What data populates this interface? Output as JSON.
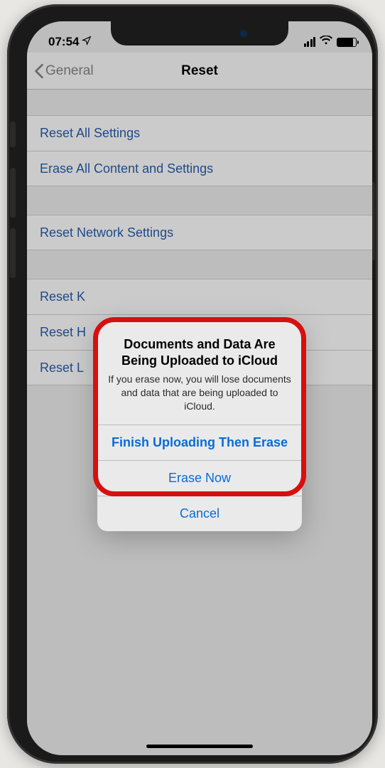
{
  "statusBar": {
    "time": "07:54"
  },
  "nav": {
    "back": "General",
    "title": "Reset"
  },
  "groups": [
    {
      "rows": [
        {
          "label": "Reset All Settings"
        },
        {
          "label": "Erase All Content and Settings"
        }
      ]
    },
    {
      "rows": [
        {
          "label": "Reset Network Settings"
        }
      ]
    },
    {
      "rows": [
        {
          "label": "Reset Keyboard Dictionary"
        },
        {
          "label": "Reset Home Screen Layout"
        },
        {
          "label": "Reset Location & Privacy"
        }
      ]
    }
  ],
  "visibleRowPrefixes": {
    "r3a": "Reset K",
    "r3b": "Reset H",
    "r3c": "Reset L"
  },
  "alert": {
    "title": "Documents and Data Are Being Uploaded to iCloud",
    "message": "If you erase now, you will lose documents and data that are being uploaded to iCloud.",
    "option1": "Finish Uploading Then Erase",
    "option2": "Erase Now",
    "cancel": "Cancel"
  }
}
